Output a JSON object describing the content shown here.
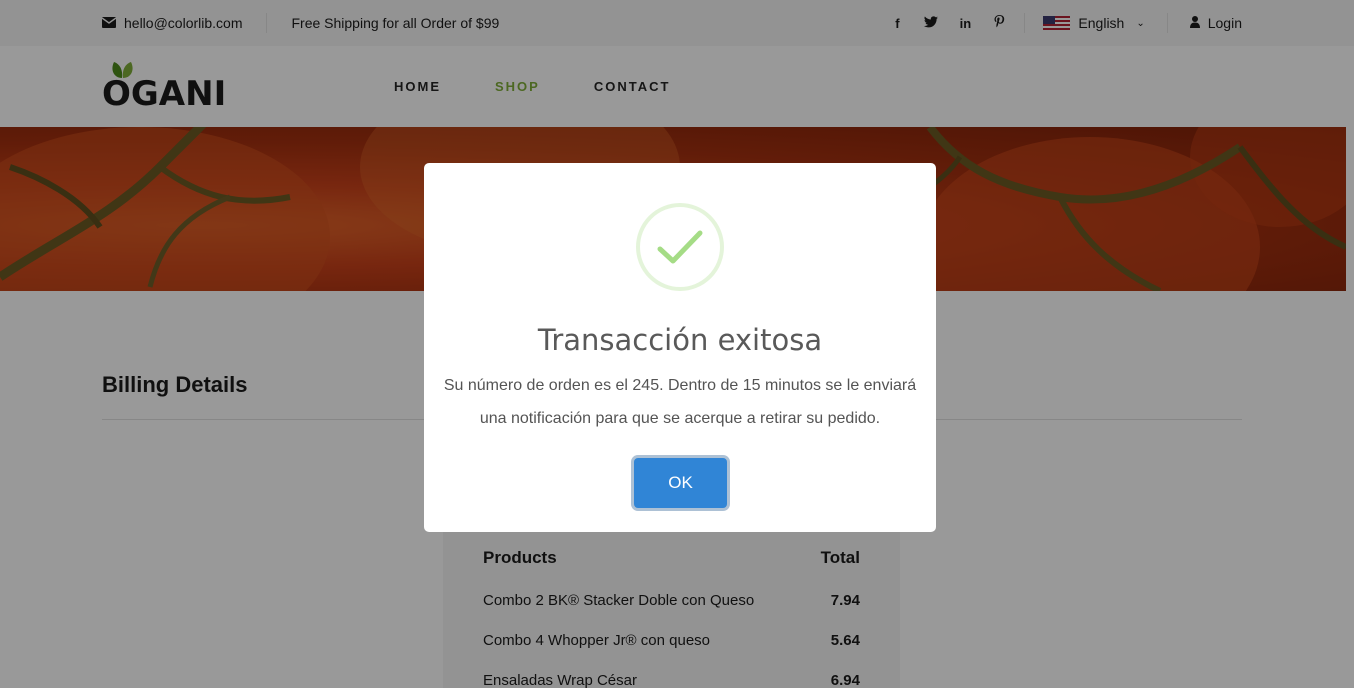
{
  "topbar": {
    "email": "hello@colorlib.com",
    "shipping": "Free Shipping for all Order of $99",
    "language": "English",
    "login": "Login"
  },
  "header": {
    "logo": "OGANI",
    "nav": [
      "HOME",
      "SHOP",
      "CONTACT"
    ],
    "active_nav": "SHOP"
  },
  "billing": {
    "title": "Billing Details"
  },
  "order": {
    "col_products": "Products",
    "col_total": "Total",
    "items": [
      {
        "name": "Combo 2 BK® Stacker Doble con Queso",
        "price": "7.94"
      },
      {
        "name": "Combo 4 Whopper Jr® con queso",
        "price": "5.64"
      },
      {
        "name": "Ensaladas Wrap César",
        "price": "6.94"
      }
    ]
  },
  "modal": {
    "title": "Transacción exitosa",
    "text": "Su número de orden es el 245. Dentro de 15 minutos se le enviará una notificación para que se acerque a retirar su pedido.",
    "ok": "OK"
  },
  "colors": {
    "accent_green": "#7fad39",
    "ok_blue": "#3085d6",
    "success_check": "#a5dc86"
  }
}
